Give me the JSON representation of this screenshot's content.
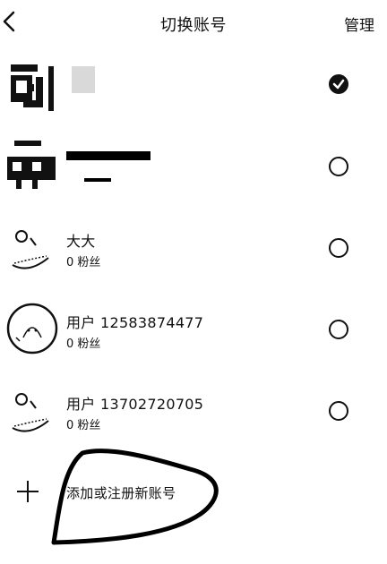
{
  "header": {
    "title": "切换账号",
    "manage_label": "管理"
  },
  "accounts": [
    {
      "name": "",
      "fans": "",
      "selected": true,
      "avatar_icon": "qr-code-pixel-avatar"
    },
    {
      "name": "",
      "fans": "",
      "selected": false,
      "avatar_icon": "pixel-robot-avatar"
    },
    {
      "name": "大大",
      "fans": "0 粉丝",
      "selected": false,
      "avatar_icon": "boat-sketch-avatar"
    },
    {
      "name": "用户 12583874477",
      "fans": "0 粉丝",
      "selected": false,
      "avatar_icon": "cartoon-circle-avatar"
    },
    {
      "name": "用户 13702720705",
      "fans": "0 粉丝",
      "selected": false,
      "avatar_icon": "boat-sketch-avatar"
    }
  ],
  "add_account": {
    "label": "添加或注册新账号",
    "icon": "plus-icon"
  },
  "colors": {
    "foreground": "#111111",
    "background": "#ffffff"
  }
}
